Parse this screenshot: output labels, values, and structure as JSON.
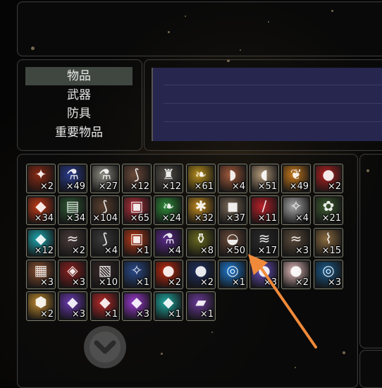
{
  "menu": {
    "items": [
      {
        "label": "物品",
        "selected": true
      },
      {
        "label": "武器",
        "selected": false
      },
      {
        "label": "防具",
        "selected": false
      },
      {
        "label": "重要物品",
        "selected": false
      }
    ]
  },
  "inventory": {
    "rows": [
      [
        {
          "icon": "red-amulet",
          "qty": "×2",
          "color": "#8a2a14"
        },
        {
          "icon": "blue-potion",
          "qty": "×49",
          "color": "#2a3b8a"
        },
        {
          "icon": "white-potion",
          "qty": "×27",
          "color": "#8c8a80"
        },
        {
          "icon": "claw",
          "qty": "×12",
          "color": "#6b4a3a"
        },
        {
          "icon": "armor-trinket",
          "qty": "×12",
          "color": "#55504a"
        },
        {
          "icon": "gold-leaf",
          "qty": "×61",
          "color": "#b8901e"
        },
        {
          "icon": "meat",
          "qty": "×4",
          "color": "#a15a3c"
        },
        {
          "icon": "bread",
          "qty": "×51",
          "color": "#b39a7a"
        },
        {
          "icon": "corn-pepper",
          "qty": "×49",
          "color": "#c87a1e"
        },
        {
          "icon": "apple",
          "qty": "×2",
          "color": "#b22222"
        }
      ],
      [
        {
          "icon": "red-gem-box",
          "qty": "×34",
          "color": "#c23a1a"
        },
        {
          "icon": "green-book",
          "qty": "×34",
          "color": "#2f5a34"
        },
        {
          "icon": "branch",
          "qty": "×104",
          "color": "#5a4030"
        },
        {
          "icon": "red-crate",
          "qty": "×65",
          "color": "#b0303a"
        },
        {
          "icon": "green-leaf",
          "qty": "×24",
          "color": "#2f8a3a"
        },
        {
          "icon": "gold-bundle",
          "qty": "×32",
          "color": "#c08a20"
        },
        {
          "icon": "ore-stone",
          "qty": "×37",
          "color": "#7a6a58"
        },
        {
          "icon": "red-vial",
          "qty": "×11",
          "color": "#b8202a"
        },
        {
          "icon": "white-shard",
          "qty": "×4",
          "color": "#a8a8a8"
        },
        {
          "icon": "herb-bundle",
          "qty": "×21",
          "color": "#3c5a30"
        }
      ],
      [
        {
          "icon": "cyan-gem",
          "qty": "×12",
          "color": "#1fa8b0"
        },
        {
          "icon": "dark-feather",
          "qty": "×2",
          "color": "#4a3a3a"
        },
        {
          "icon": "black-claw",
          "qty": "×4",
          "color": "#3a3a3a"
        },
        {
          "icon": "gift-box",
          "qty": "×1",
          "color": "#b83a1a"
        },
        {
          "icon": "purple-potion",
          "qty": "×4",
          "color": "#5a2a8a"
        },
        {
          "icon": "dark-bottle",
          "qty": "×8",
          "color": "#6a6a20"
        },
        {
          "icon": "ore-chunk",
          "qty": "×50",
          "color": "#6a4a3a"
        },
        {
          "icon": "black-wing",
          "qty": "×17",
          "color": "#2a2a2a"
        },
        {
          "icon": "wing-feathers",
          "qty": "×3",
          "color": "#5a4a3a"
        },
        {
          "icon": "scroll",
          "qty": "×15",
          "color": "#8a6a40"
        }
      ],
      [
        {
          "icon": "leather-hide",
          "qty": "×3",
          "color": "#8a5030"
        },
        {
          "icon": "dark-crystal",
          "qty": "×3",
          "color": "#8a2020"
        },
        {
          "icon": "black-hide",
          "qty": "×10",
          "color": "#3a2a2a"
        },
        {
          "icon": "blue-rune-card",
          "qty": "×1",
          "color": "#2a4a8a"
        },
        {
          "icon": "red-orb",
          "qty": "×2",
          "color": "#c02a10"
        },
        {
          "icon": "dark-blue-orb",
          "qty": "×2",
          "color": "#203060"
        },
        {
          "icon": "swirl-blue-orb",
          "qty": "×1",
          "color": "#1f7ad0"
        },
        {
          "icon": "violet-orb",
          "qty": "×3",
          "color": "#6a50c0"
        },
        {
          "icon": "pink-pearl",
          "qty": "×2",
          "color": "#e0b8b8"
        },
        {
          "icon": "blue-cosmic-orb",
          "qty": "×3",
          "color": "#1a5a8a"
        }
      ],
      [
        {
          "icon": "amber-gem",
          "qty": "×2",
          "color": "#c08a30"
        },
        {
          "icon": "violet-shard",
          "qty": "×3",
          "color": "#6a3ab0"
        },
        {
          "icon": "red-crystal",
          "qty": "×1",
          "color": "#b82a2a"
        },
        {
          "icon": "purple-crystal",
          "qty": "×3",
          "color": "#9a3ad0"
        },
        {
          "icon": "teal-gem",
          "qty": "×1",
          "color": "#20a8a0"
        },
        {
          "icon": "purple-slab",
          "qty": "×1",
          "color": "#6a3a9a"
        }
      ]
    ]
  },
  "scroll_button": {
    "icon": "chevron-down-icon"
  },
  "annotation": {
    "icon": "orange-pointer-arrow",
    "color": "#f08a3a"
  }
}
